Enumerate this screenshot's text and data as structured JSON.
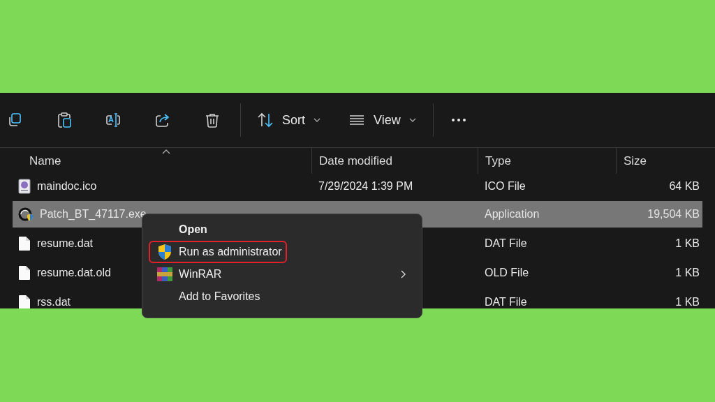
{
  "toolbar": {
    "sort_label": "Sort",
    "view_label": "View"
  },
  "columns": [
    {
      "label": "Name",
      "sorted": true
    },
    {
      "label": "Date modified",
      "sorted": false
    },
    {
      "label": "Type",
      "sorted": false
    },
    {
      "label": "Size",
      "sorted": false
    }
  ],
  "files": [
    {
      "name": "maindoc.ico",
      "kind": "icon",
      "date": "7/29/2024 1:39 PM",
      "type": "ICO File",
      "size": "64 KB",
      "selected": false
    },
    {
      "name": "Patch_BT_47117.exe",
      "kind": "app",
      "type": "Application",
      "size": "19,504 KB",
      "selected": true
    },
    {
      "name": "resume.dat",
      "kind": "file",
      "type": "DAT File",
      "size": "1 KB",
      "selected": false
    },
    {
      "name": "resume.dat.old",
      "kind": "file",
      "type": "OLD File",
      "size": "1 KB",
      "selected": false
    },
    {
      "name": "rss.dat",
      "kind": "file",
      "type": "DAT File",
      "size": "1 KB",
      "selected": false
    }
  ],
  "context_menu": {
    "items": [
      {
        "label": "Open",
        "kind": "default",
        "highlighted": false,
        "submenu": false
      },
      {
        "label": "Run as administrator",
        "kind": "shield",
        "highlighted": true,
        "submenu": false
      },
      {
        "label": "WinRAR",
        "kind": "winrar",
        "highlighted": false,
        "submenu": true
      },
      {
        "label": "Add to Favorites",
        "kind": "plain",
        "highlighted": false,
        "submenu": false
      }
    ]
  }
}
